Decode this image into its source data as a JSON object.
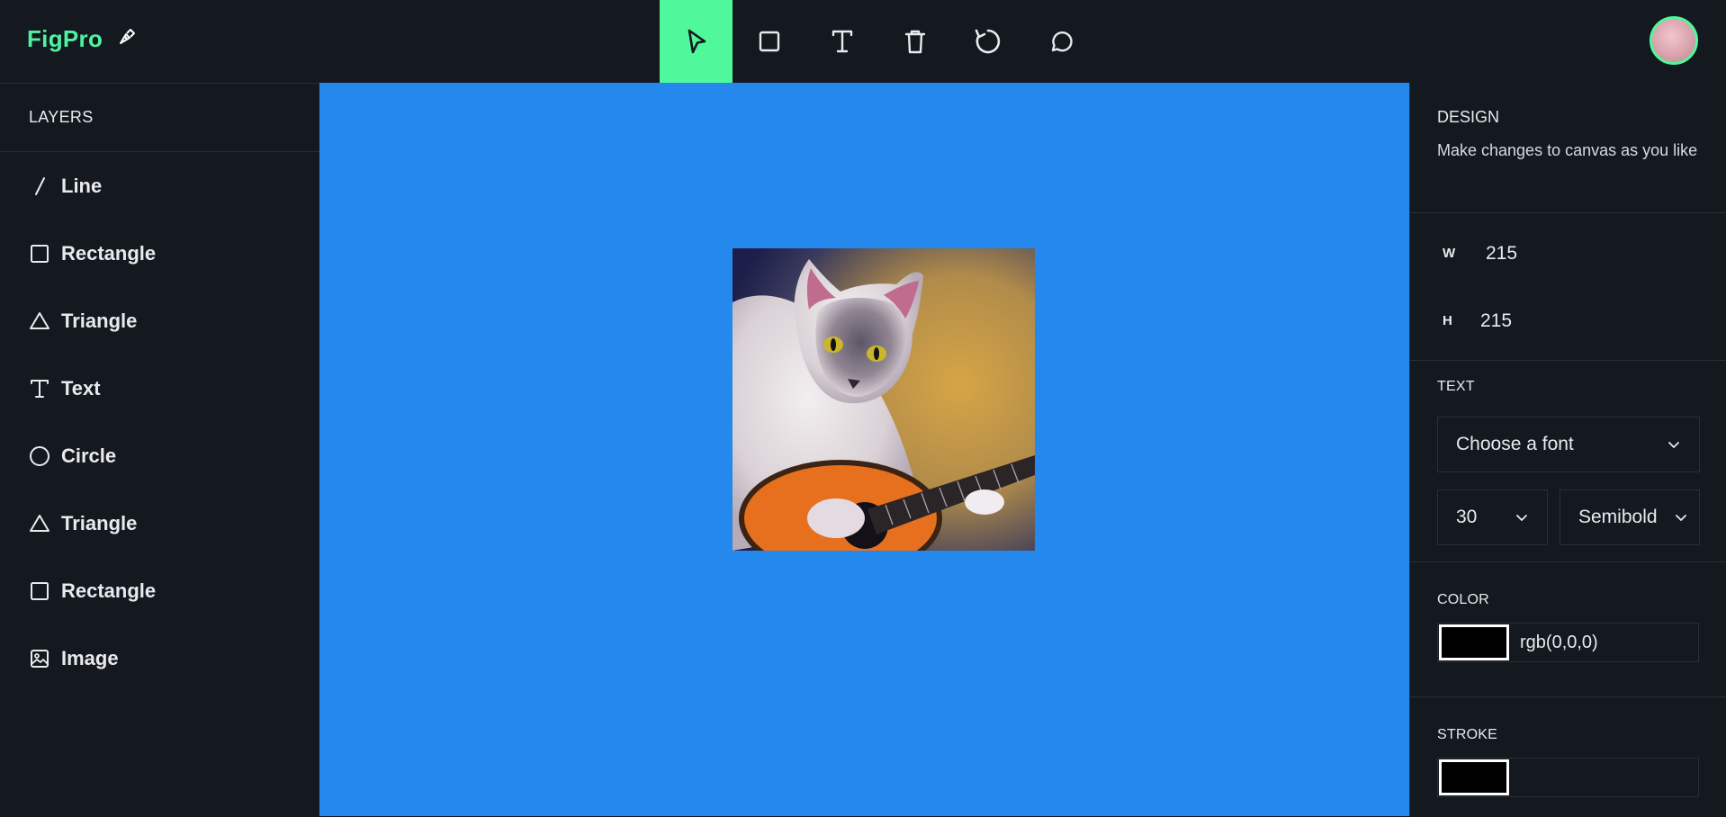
{
  "app": {
    "logo": "FigPro"
  },
  "toolbar": {
    "tools": [
      {
        "name": "select",
        "icon": "cursor-icon",
        "active": true
      },
      {
        "name": "rectangle",
        "icon": "square-icon"
      },
      {
        "name": "text",
        "icon": "text-icon"
      },
      {
        "name": "delete",
        "icon": "trash-icon"
      },
      {
        "name": "reset",
        "icon": "rotate-icon"
      },
      {
        "name": "comments",
        "icon": "chat-bubble-icon"
      }
    ],
    "accent": "#4ff89b"
  },
  "layers": {
    "title": "LAYERS",
    "items": [
      {
        "label": "Line",
        "icon": "line-icon"
      },
      {
        "label": "Rectangle",
        "icon": "rectangle-icon"
      },
      {
        "label": "Triangle",
        "icon": "triangle-icon"
      },
      {
        "label": "Text",
        "icon": "text-icon"
      },
      {
        "label": "Circle",
        "icon": "circle-icon"
      },
      {
        "label": "Triangle",
        "icon": "triangle-icon"
      },
      {
        "label": "Rectangle",
        "icon": "rectangle-icon"
      },
      {
        "label": "Image",
        "icon": "image-icon"
      }
    ]
  },
  "canvas": {
    "background": "#2588ec"
  },
  "design": {
    "title": "DESIGN",
    "subtitle": "Make changes to canvas as you like",
    "width_label": "W",
    "width_value": "215",
    "height_label": "H",
    "height_value": "215",
    "text": {
      "title": "TEXT",
      "font_placeholder": "Choose a font",
      "font_size": "30",
      "font_weight": "Semibold"
    },
    "color": {
      "title": "COLOR",
      "value": "rgb(0,0,0)",
      "swatch": "#000000"
    },
    "stroke": {
      "title": "STROKE",
      "swatch": "#000000"
    }
  }
}
